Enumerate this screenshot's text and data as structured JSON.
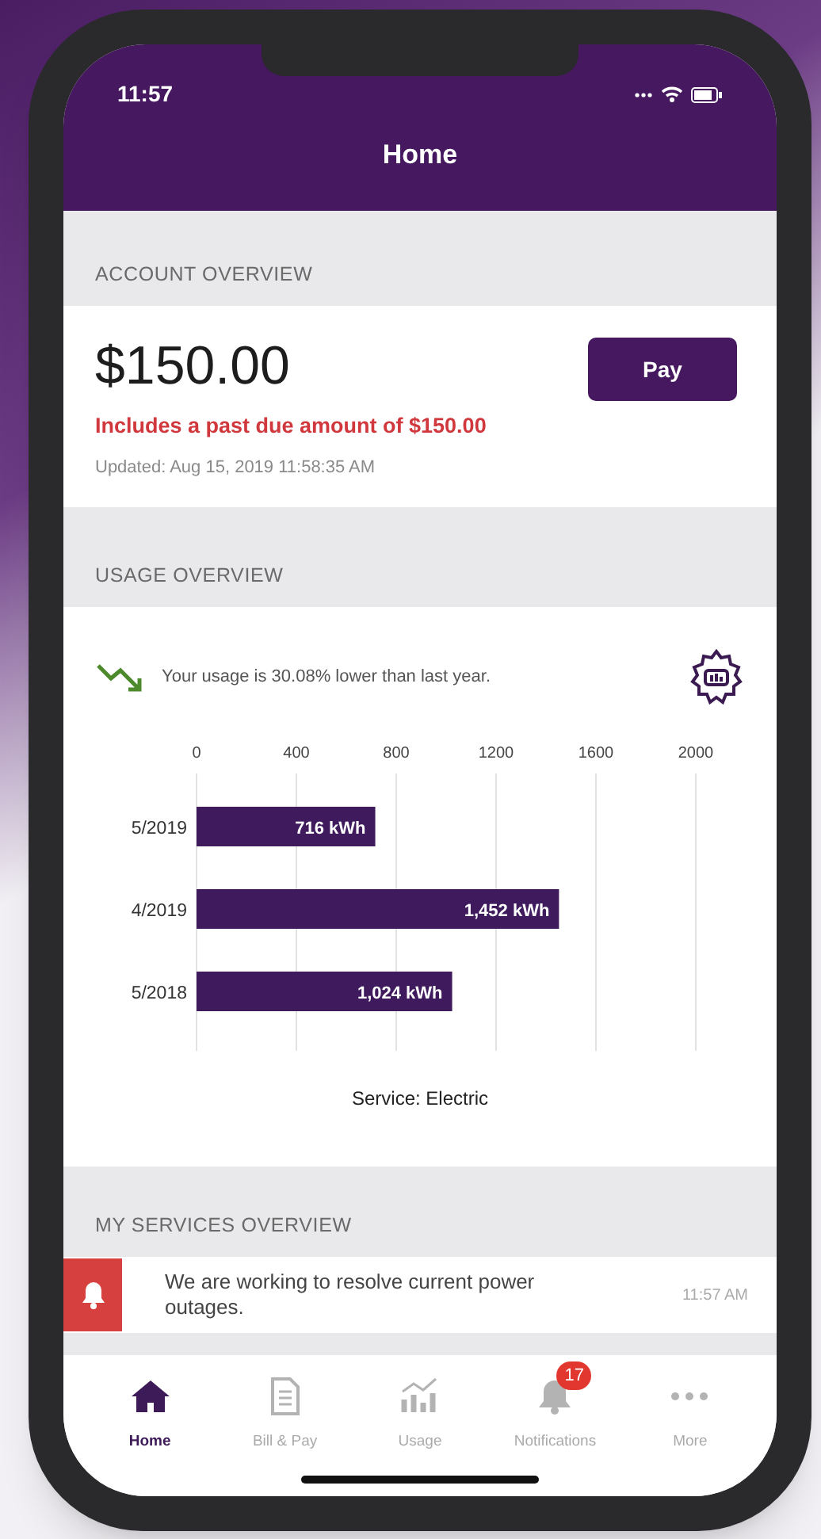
{
  "status_bar": {
    "time": "11:57"
  },
  "header": {
    "title": "Home"
  },
  "account_overview": {
    "heading": "ACCOUNT OVERVIEW",
    "amount": "$150.00",
    "past_due": "Includes a past due amount of $150.00",
    "updated": "Updated: Aug 15, 2019 11:58:35 AM",
    "pay_button": "Pay"
  },
  "usage_overview": {
    "heading": "USAGE OVERVIEW",
    "summary": "Your usage is 30.08% lower than last year.",
    "chart_data": {
      "type": "bar",
      "orientation": "horizontal",
      "xlabel": "Service: Electric",
      "categories": [
        "5/2019",
        "4/2019",
        "5/2018"
      ],
      "series": [
        {
          "color": "#3f1a5c",
          "values": [
            716,
            1452,
            1024
          ]
        }
      ],
      "xlim": [
        0,
        2000
      ],
      "xticks": [
        0,
        400,
        800,
        1200,
        1600,
        2000
      ],
      "grid": true,
      "value_labels": [
        "716 kWh",
        "1,452 kWh",
        "1,024 kWh"
      ]
    }
  },
  "services_overview": {
    "heading": "MY SERVICES OVERVIEW",
    "notifications": [
      {
        "message": "We are working to resolve current power outages.",
        "time": "11:57 AM"
      }
    ]
  },
  "tab_bar": [
    {
      "kind": "home",
      "label": "Home",
      "selected": true
    },
    {
      "kind": "bill",
      "label": "Bill & Pay",
      "selected": false
    },
    {
      "kind": "usage",
      "label": "Usage",
      "selected": false
    },
    {
      "kind": "bell",
      "label": "Notifications",
      "selected": false,
      "badge": "17"
    },
    {
      "kind": "more",
      "label": "More",
      "selected": false
    }
  ]
}
